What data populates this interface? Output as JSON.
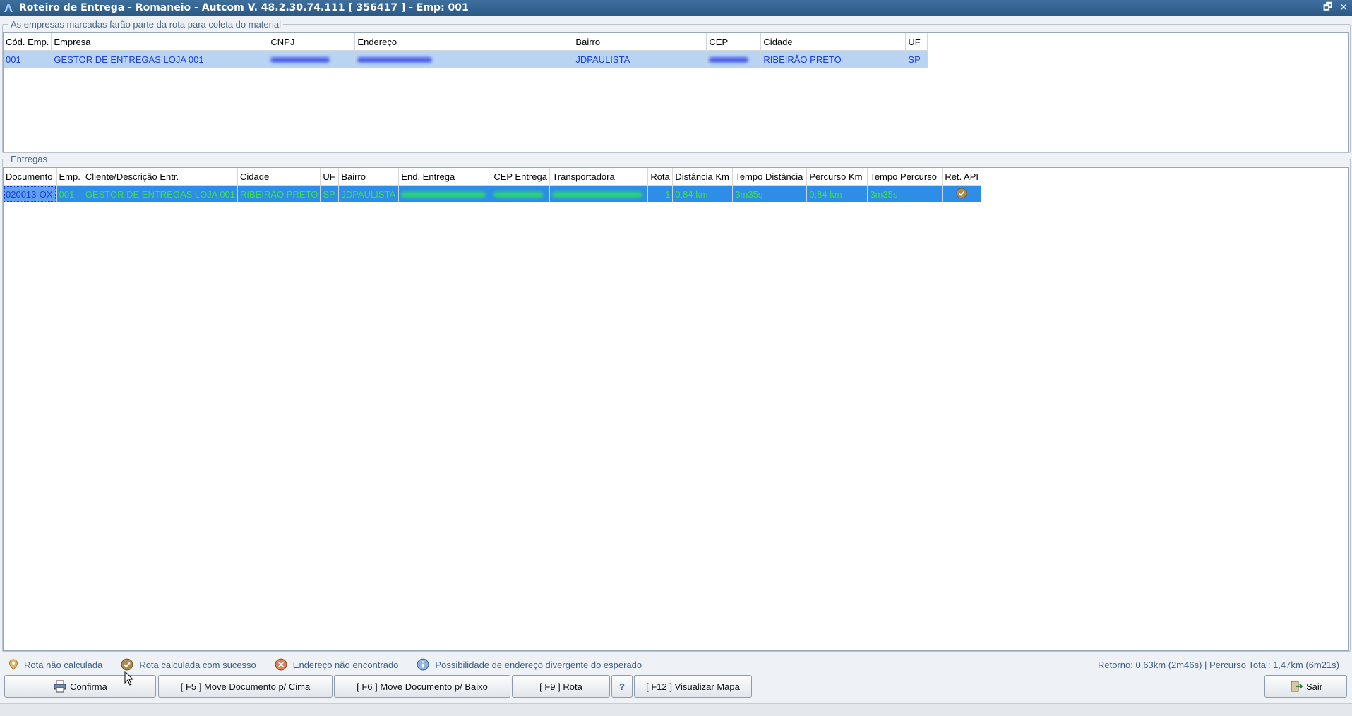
{
  "window": {
    "title": "Roteiro de Entrega  - Romaneio  -  Autcom V. 48.2.30.74.111 [ 356417 ] - Emp: 001",
    "restore_glyph": "🗗",
    "close_glyph": "✕"
  },
  "empresas": {
    "legend": "As empresas marcadas farão parte da rota para coleta do material",
    "columns": [
      "Cód. Emp.",
      "Empresa",
      "CNPJ",
      "Endereço",
      "Bairro",
      "CEP",
      "Cidade",
      "UF"
    ],
    "rows": [
      {
        "cod": "001",
        "empresa": "GESTOR DE ENTREGAS LOJA 001",
        "bairro": "JDPAULISTA",
        "cidade": "RIBEIRÃO PRETO",
        "uf": "SP"
      }
    ]
  },
  "entregas": {
    "legend": "Entregas",
    "columns": [
      "Documento",
      "Emp.",
      "Cliente/Descrição Entr.",
      "Cidade",
      "UF",
      "Bairro",
      "End. Entrega",
      "CEP Entrega",
      "Transportadora",
      "Rota",
      "Distância Km",
      "Tempo Distância",
      "Percurso Km",
      "Tempo Percurso",
      "Ret. API"
    ],
    "rows": [
      {
        "documento": "020013-OX",
        "emp": "001",
        "cliente": "GESTOR DE ENTREGAS LOJA 001",
        "cidade": "RIBEIRÃO PRETO",
        "uf": "SP",
        "bairro": "JDPAULISTA",
        "rota": "1",
        "distancia": "0,84 km",
        "tempo_distancia": "3m35s",
        "percurso": "0,84 km",
        "tempo_percurso": "3m35s",
        "ret_api_icon": "check-badge-icon"
      }
    ]
  },
  "legend_items": [
    {
      "icon": "pin-icon",
      "label": "Rota não calculada"
    },
    {
      "icon": "check-badge-icon",
      "label": "Rota calculada com sucesso"
    },
    {
      "icon": "error-icon",
      "label": "Endereço não encontrado"
    },
    {
      "icon": "info-icon",
      "label": "Possibilidade de endereço divergente do esperado"
    }
  ],
  "totals": "Retorno: 0,63km (2m46s)  |  Percurso Total: 1,47km (6m21s)",
  "buttons": {
    "confirma": "Confirma",
    "move_up": "[ F5 ] Move Documento p/ Cima",
    "move_down": "[ F6 ] Move Documento p/ Baixo",
    "rota": "[ F9 ] Rota",
    "help": "?",
    "mapa": "[ F12 ] Visualizar Mapa",
    "sair": "Sair"
  },
  "colors": {
    "titlebar": "#2b5a87",
    "selected_row_light": "#b9d3f2",
    "selected_row_dark": "#2e8de6",
    "text_blue": "#1b3fd6",
    "text_green": "#39e347"
  }
}
